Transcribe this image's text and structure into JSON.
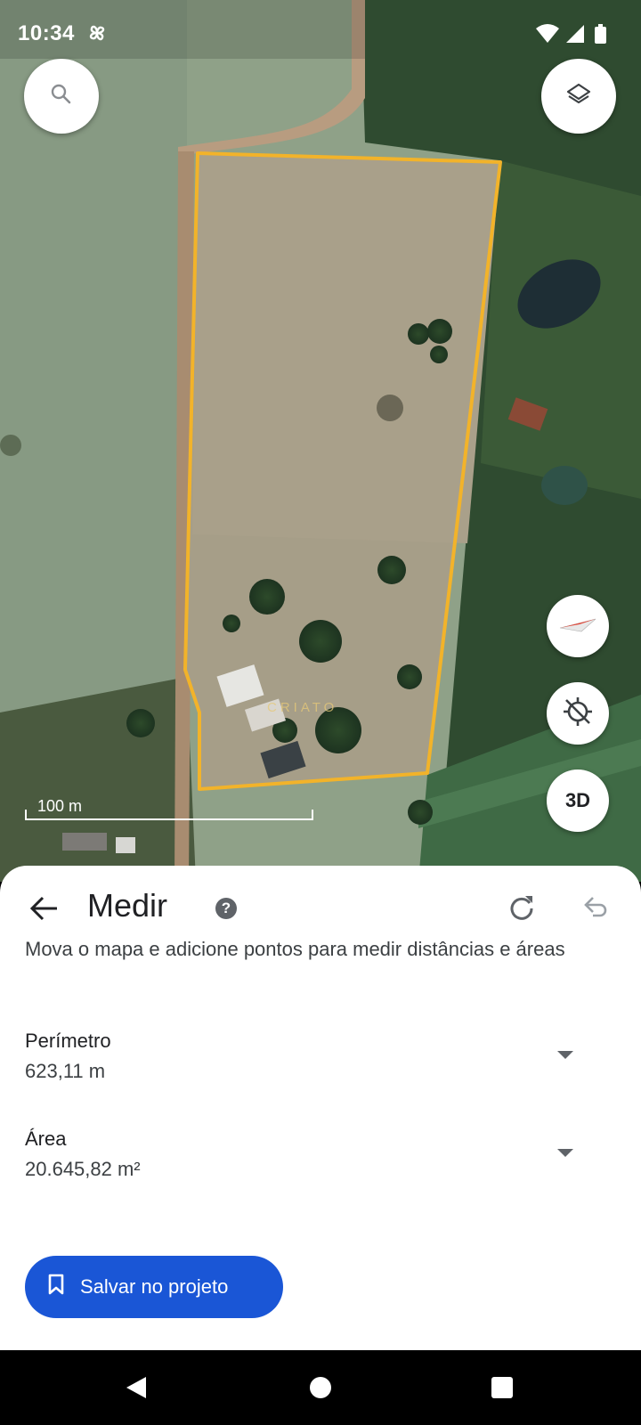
{
  "status_bar": {
    "time": "10:34"
  },
  "map": {
    "scale_label": "100 m",
    "watermark": "CRIATO",
    "three_d_label": "3D",
    "outline_color": "#f2b32a"
  },
  "measure_panel": {
    "title": "Medir",
    "help_label": "?",
    "description": "Mova o mapa e adicione pontos para medir distâncias e áreas",
    "perimeter": {
      "label": "Perímetro",
      "value": "623,11 m"
    },
    "area": {
      "label": "Área",
      "value": "20.645,82 m²"
    },
    "save_button_label": "Salvar no projeto",
    "accent_color": "#1a56d6"
  }
}
